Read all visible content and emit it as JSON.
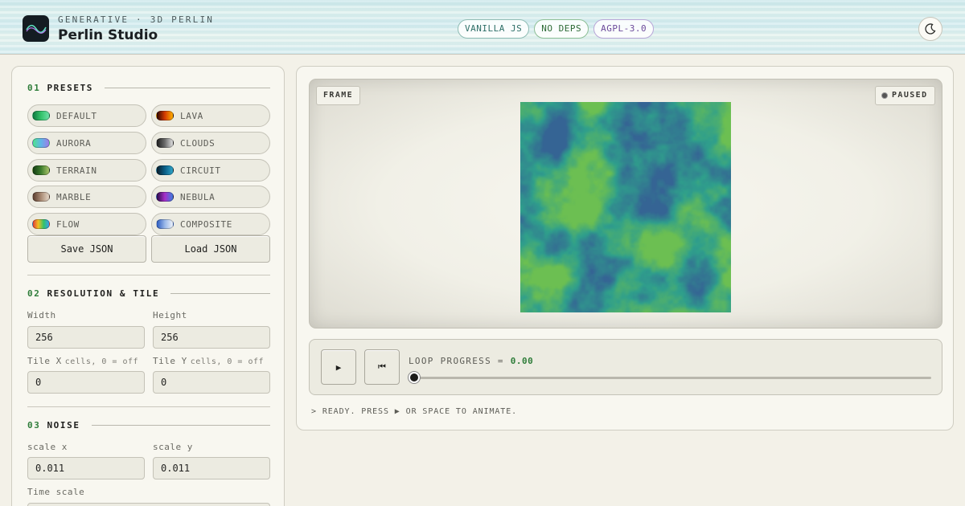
{
  "header": {
    "kicker": "GENERATIVE · 3D PERLIN",
    "title": "Perlin Studio",
    "badges": [
      "VANILLA JS",
      "NO DEPS",
      "AGPL-3.0"
    ],
    "theme_icon": "moon-icon"
  },
  "sidebar": {
    "presets": {
      "num": "01",
      "title": "PRESETS",
      "items": [
        {
          "label": "DEFAULT",
          "swatch": "green gradient"
        },
        {
          "label": "LAVA",
          "swatch": "red-orange gradient"
        },
        {
          "label": "AURORA",
          "swatch": "green-blue-purple gradient"
        },
        {
          "label": "CLOUDS",
          "swatch": "grey gradient"
        },
        {
          "label": "TERRAIN",
          "swatch": "olive gradient"
        },
        {
          "label": "CIRCUIT",
          "swatch": "teal gradient"
        },
        {
          "label": "MARBLE",
          "swatch": "brown-beige gradient"
        },
        {
          "label": "NEBULA",
          "swatch": "purple-blue gradient"
        },
        {
          "label": "FLOW",
          "swatch": "rainbow gradient"
        },
        {
          "label": "COMPOSITE",
          "swatch": "blue-white gradient"
        }
      ],
      "save_label": "Save JSON",
      "load_label": "Load JSON"
    },
    "resolution": {
      "num": "02",
      "title": "RESOLUTION & TILE",
      "width_label": "Width",
      "width_value": "256",
      "height_label": "Height",
      "height_value": "256",
      "tile_x_label": "Tile X",
      "tile_x_hint": "cells, 0 = off",
      "tile_x_value": "0",
      "tile_y_label": "Tile Y",
      "tile_y_hint": "cells, 0 = off",
      "tile_y_value": "0"
    },
    "noise": {
      "num": "03",
      "title": "NOISE",
      "scale_x_label": "scale x",
      "scale_x_value": "0.011",
      "scale_y_label": "scale y",
      "scale_y_value": "0.011",
      "time_scale_label": "Time scale"
    }
  },
  "viewer": {
    "frame_label": "FRAME",
    "state_label": "PAUSED",
    "play_icon": "play-icon",
    "play_glyph": "▶",
    "restart_icon": "skip-to-start-icon",
    "restart_glyph": "⏮",
    "loop_label": "LOOP PROGRESS = ",
    "loop_value": "0.00",
    "loop_progress": 0,
    "status": "> READY. PRESS ▶ OR SPACE TO ANIMATE."
  },
  "colors": {
    "accent_green": "#2f7d3a",
    "noise_low": "#356494",
    "noise_mid": "#2f9f8c",
    "noise_high": "#6cbf52"
  }
}
